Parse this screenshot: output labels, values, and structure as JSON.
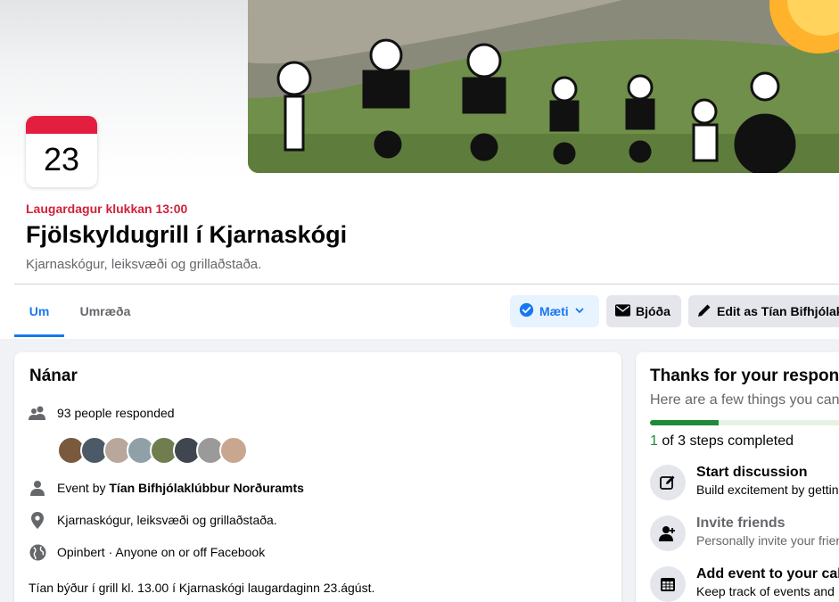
{
  "event": {
    "day": "23",
    "when": "Laugardagur klukkan 13:00",
    "title": "Fjölskyldugrill í Kjarnaskógi",
    "location_subtitle": "Kjarnaskógur, leiksvæði og grillaðstaða."
  },
  "tabs": [
    {
      "label": "Um",
      "active": true
    },
    {
      "label": "Umræða",
      "active": false
    }
  ],
  "actions": {
    "going_label": "Mæti",
    "invite_label": "Bjóða",
    "edit_label": "Edit as Tían Bifhjólaklúbbur Norðuramts"
  },
  "details": {
    "title": "Nánar",
    "responded": "93 people responded",
    "event_by_prefix": "Event by ",
    "event_by_name": "Tían Bifhjólaklúbbur Norðuramts",
    "location": "Kjarnaskógur, leiksvæði og grillaðstaða.",
    "privacy": "Opinbert · Anyone on or off Facebook",
    "description_line1": "Tían býður í grill kl. 13.00 í Kjarnaskógi laugardaginn 23.ágúst."
  },
  "response_panel": {
    "title": "Thanks for your response",
    "subtitle": "Here are a few things you can do",
    "steps_done": "1",
    "steps_text": " of 3 steps completed",
    "progress": 0.333,
    "items": [
      {
        "title": "Start discussion",
        "desc": "Build excitement by getting",
        "icon": "edit-icon"
      },
      {
        "title": "Invite friends",
        "desc": "Personally invite your friends",
        "icon": "person-add-icon"
      },
      {
        "title": "Add event to your calendar",
        "desc": "Keep track of events and",
        "icon": "calendar-icon"
      }
    ]
  },
  "colors": {
    "accent": "#1877f2",
    "date_red": "#e41e3f",
    "progress_green": "#1f8a3a"
  }
}
